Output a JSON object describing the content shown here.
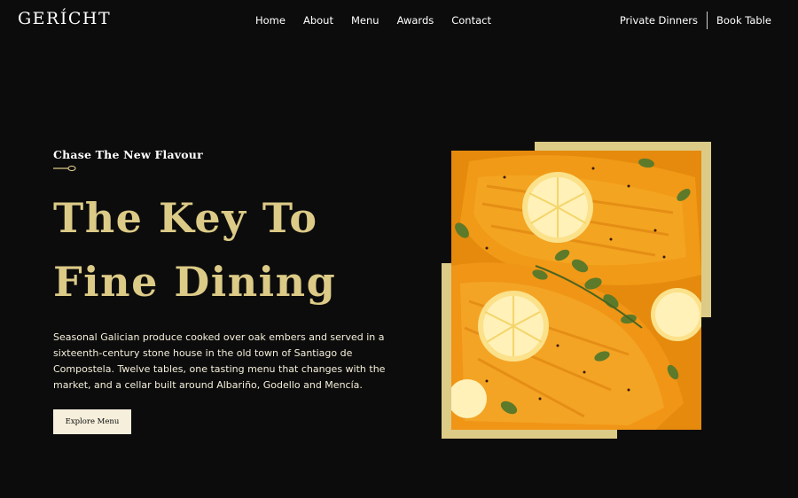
{
  "nav": {
    "logo": "GERÍCHT",
    "links": [
      "Home",
      "About",
      "Menu",
      "Awards",
      "Contact"
    ],
    "private_dinners": "Private Dinners",
    "book_table": "Book Table"
  },
  "hero": {
    "subtitle": "Chase The New Flavour",
    "headline_line1": "The Key To",
    "headline_line2": "Fine Dining",
    "description": "Seasonal Galician produce cooked over oak embers and served in a sixteenth-century stone house in the old town of Santiago de Compostela. Twelve tables, one tasting menu that changes with the market, and a cellar built around Albariño, Godello and Mencía.",
    "cta_label": "Explore Menu",
    "image_alt": "Roasted salmon fillets with lemon slices and oregano"
  },
  "colors": {
    "background": "#0c0c0c",
    "gold": "#dcca87",
    "cream": "#f5efdb",
    "white": "#ffffff"
  },
  "icons": [
    "spoon-icon"
  ]
}
